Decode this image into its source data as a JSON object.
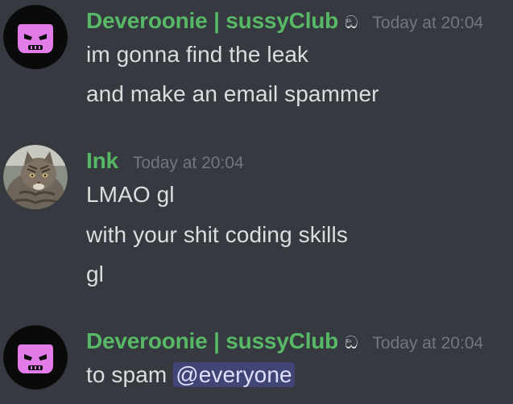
{
  "messages": [
    {
      "author": "Deveroonie | sussyClub",
      "badge": "ඞ",
      "timestamp": "Today at 20:04",
      "avatar_icon": "pink-ninja-mask-icon",
      "lines": [
        "im gonna find the leak",
        "and make an email spammer"
      ]
    },
    {
      "author": "Ink",
      "timestamp": "Today at 20:04",
      "avatar_icon": "tabby-cat-avatar",
      "lines": [
        "LMAO gl",
        "with your shit coding skills",
        "gl"
      ]
    },
    {
      "author": "Deveroonie | sussyClub",
      "badge": "ඞ",
      "timestamp": "Today at 20:04",
      "avatar_icon": "pink-ninja-mask-icon",
      "line_prefix": "to spam ",
      "mention": "@everyone"
    }
  ],
  "colors": {
    "background": "#36393f",
    "username": "#57b866",
    "text": "#dcddde",
    "timestamp": "#72767d",
    "mention_bg": "#414675",
    "avatar_pink": "#e17ce9"
  }
}
